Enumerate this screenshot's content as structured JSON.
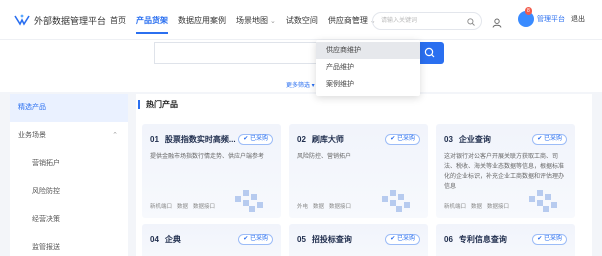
{
  "brand": {
    "title": "外部数据管理平台"
  },
  "nav": {
    "items": [
      {
        "label": "首页",
        "active": false,
        "dropdown": false
      },
      {
        "label": "产品货架",
        "active": true,
        "dropdown": false
      },
      {
        "label": "数据应用案例",
        "active": false,
        "dropdown": false
      },
      {
        "label": "场景地图",
        "active": false,
        "dropdown": true
      },
      {
        "label": "试数空间",
        "active": false,
        "dropdown": false
      },
      {
        "label": "供应商管理",
        "active": false,
        "dropdown": true
      }
    ]
  },
  "top_search": {
    "placeholder": "请输入关键词"
  },
  "user": {
    "admin_label": "管理平台",
    "badge_count": "8",
    "logout_label": "退出"
  },
  "dropdown": {
    "items": [
      {
        "label": "供应商维护",
        "hover": true
      },
      {
        "label": "产品维护",
        "hover": false
      },
      {
        "label": "案例维护",
        "hover": false
      }
    ]
  },
  "more_search": "更多筛选 ▾",
  "sidebar": {
    "items": [
      {
        "label": "精选产品",
        "active": true,
        "sub": false,
        "expand": false
      },
      {
        "label": "业务场景",
        "active": false,
        "sub": false,
        "expand": true
      },
      {
        "label": "营销拓户",
        "active": false,
        "sub": true,
        "expand": false
      },
      {
        "label": "风险防控",
        "active": false,
        "sub": true,
        "expand": false
      },
      {
        "label": "经营决策",
        "active": false,
        "sub": true,
        "expand": false
      },
      {
        "label": "监管报送",
        "active": false,
        "sub": true,
        "expand": false
      }
    ]
  },
  "section_title": "热门产品",
  "cards": [
    {
      "num": "01",
      "title": "股票指数实时高频...",
      "badge": "已采购",
      "desc": "提供金融市场指数行情走势、供应户端参考",
      "tags": [
        "新机端口",
        "数据",
        "数据接口"
      ]
    },
    {
      "num": "02",
      "title": "刷库大师",
      "badge": "已采购",
      "desc": "风险防控、营销拓户",
      "tags": [
        "外电",
        "数据",
        "数据接口"
      ]
    },
    {
      "num": "03",
      "title": "企业查询",
      "badge": "已采购",
      "desc": "这对银行对公客户开展关联方获取工商、司法、税收、海关等业态数据等信息，根据标准化的企业标识，补充企业工商数据和评估理办信息",
      "tags": [
        "新机端口",
        "数据",
        "数据接口"
      ]
    },
    {
      "num": "04",
      "title": "企典",
      "badge": "已采购",
      "desc": "",
      "tags": []
    },
    {
      "num": "05",
      "title": "招投标查询",
      "badge": "已采购",
      "desc": "",
      "tags": []
    },
    {
      "num": "06",
      "title": "专利信息查询",
      "badge": "已采购",
      "desc": "",
      "tags": []
    }
  ],
  "colors": {
    "accent": "#2a6ff0",
    "badge_red": "#f25b4b"
  }
}
